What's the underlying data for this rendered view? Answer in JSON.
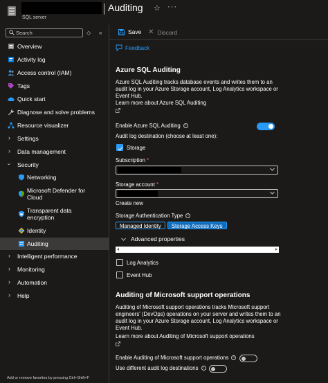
{
  "header": {
    "title": "Auditing",
    "resource_type": "SQL server",
    "star_icon": "star-icon",
    "more_icon": "more-icon"
  },
  "sidebar": {
    "search_placeholder": "Search",
    "items": [
      {
        "label": "Overview",
        "icon": "overview-icon"
      },
      {
        "label": "Activity log",
        "icon": "activity-log-icon"
      },
      {
        "label": "Access control (IAM)",
        "icon": "people-icon"
      },
      {
        "label": "Tags",
        "icon": "tag-icon"
      },
      {
        "label": "Quick start",
        "icon": "cloud-icon"
      },
      {
        "label": "Diagnose and solve problems",
        "icon": "wrench-icon"
      },
      {
        "label": "Resource visualizer",
        "icon": "graph-icon"
      },
      {
        "label": "Settings",
        "expandable": true
      },
      {
        "label": "Data management",
        "expandable": true
      },
      {
        "label": "Security",
        "expanded": true
      },
      {
        "label": "Networking",
        "icon": "shield-icon"
      },
      {
        "label": "Microsoft Defender for Cloud",
        "icon": "defender-shield-icon"
      },
      {
        "label": "Transparent data encryption",
        "icon": "encryption-shield-icon"
      },
      {
        "label": "Identity",
        "icon": "identity-icon"
      },
      {
        "label": "Auditing",
        "icon": "auditing-icon",
        "selected": true
      },
      {
        "label": "Intelligent performance",
        "expandable": true
      },
      {
        "label": "Monitoring",
        "expandable": true
      },
      {
        "label": "Automation",
        "expandable": true
      },
      {
        "label": "Help",
        "expandable": true
      }
    ],
    "footer": "Add or remove favorites by pressing Ctrl+Shift+F"
  },
  "toolbar": {
    "save_label": "Save",
    "discard_label": "Discard"
  },
  "feedback_label": "Feedback",
  "azure_auditing": {
    "title": "Azure SQL Auditing",
    "description": "Azure SQL Auditing tracks database events and writes them to an audit log in your Azure Storage account, Log Analytics workspace or Event Hub.",
    "learn_more": "Learn more about Azure SQL Auditing",
    "enable_label": "Enable Azure SQL Auditing",
    "enabled": true,
    "destination_label": "Audit log destination (choose at least one):",
    "storage_label": "Storage",
    "storage_checked": true,
    "subscription_label": "Subscription",
    "storage_account_label": "Storage account",
    "create_new": "Create new",
    "auth_type_label": "Storage Authentication Type",
    "auth_options": [
      "Managed Identity",
      "Storage Access Keys"
    ],
    "auth_selected": "Storage Access Keys",
    "advanced_label": "Advanced properties",
    "log_analytics_label": "Log Analytics",
    "log_analytics_checked": false,
    "event_hub_label": "Event Hub",
    "event_hub_checked": false
  },
  "support_auditing": {
    "title": "Auditing of Microsoft support operations",
    "description": "Auditing of Microsoft support operations tracks Microsoft support engineers' (DevOps) operations on your server and writes them to an audit log in your Azure Storage account, Log Analytics workspace or Event Hub.",
    "learn_more": "Learn more about Auditing of Microsoft support operations",
    "enable_label": "Enable Auditing of Microsoft support operations",
    "enabled": false,
    "different_dest_label": "Use different audit log destinations",
    "different_dest_enabled": false
  },
  "colors": {
    "background": "#1b1a19",
    "accent": "#2899f5",
    "selected_bg": "#3b3a39",
    "required": "#f1707b"
  }
}
